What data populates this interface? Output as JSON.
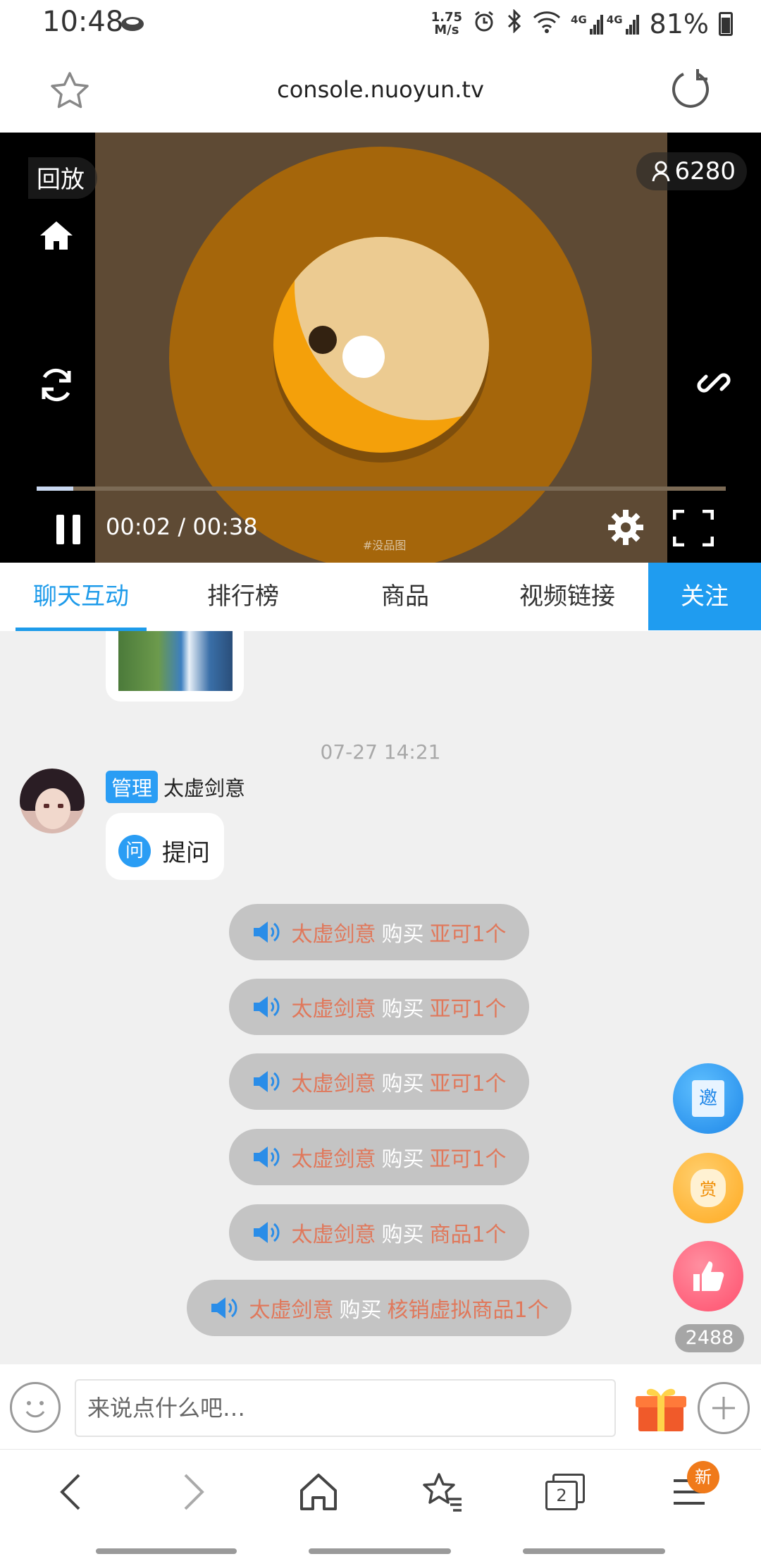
{
  "status_bar": {
    "time": "10:48",
    "net_speed_value": "1.75",
    "net_speed_unit": "M/s",
    "signal_a": "4G",
    "signal_b": "4G",
    "battery": "81%"
  },
  "browser": {
    "url": "console.nuoyun.tv"
  },
  "video": {
    "mode_label": "回放",
    "viewers": "6280",
    "elapsed": "00:02",
    "duration": "00:38",
    "progress_fraction": 0.053,
    "watermark": "#没品图"
  },
  "tabs": [
    {
      "label": "聊天互动",
      "active": true
    },
    {
      "label": "排行榜",
      "active": false
    },
    {
      "label": "商品",
      "active": false
    },
    {
      "label": "视频链接",
      "active": false
    }
  ],
  "follow_label": "关注",
  "chat": {
    "timestamp": "07-27 14:21",
    "message": {
      "role_badge": "管理",
      "username": "太虚剑意",
      "question_icon": "问",
      "text": "提问"
    },
    "notices": [
      {
        "user": "太虚剑意",
        "verb": "购买",
        "item": "亚可1个"
      },
      {
        "user": "太虚剑意",
        "verb": "购买",
        "item": "亚可1个"
      },
      {
        "user": "太虚剑意",
        "verb": "购买",
        "item": "亚可1个"
      },
      {
        "user": "太虚剑意",
        "verb": "购买",
        "item": "亚可1个"
      },
      {
        "user": "太虚剑意",
        "verb": "购买",
        "item": "商品1个"
      },
      {
        "user": "太虚剑意",
        "verb": "购买",
        "item": "核销虚拟商品1个"
      }
    ]
  },
  "float_buttons": {
    "invite_icon_text": "邀",
    "reward_icon_text": "赏",
    "like_count": "2488"
  },
  "input": {
    "placeholder": "来说点什么吧…"
  },
  "nav": {
    "tab_count": "2",
    "new_badge": "新"
  },
  "colors": {
    "accent": "#1e9bea",
    "follow_bg": "#1f9cf0",
    "notice_user": "#e0785b",
    "notice_bg": "#c4c4c4"
  }
}
